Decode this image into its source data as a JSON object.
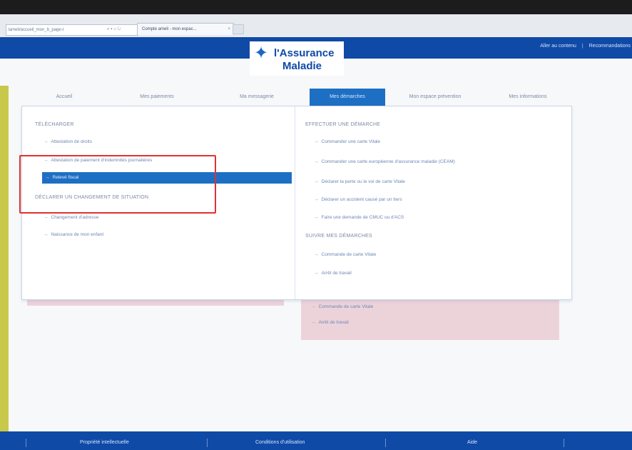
{
  "browser": {
    "address": "/ameli/accueil_mon_b_page-r",
    "address_icons": "⌕ ▾ ⌂ ↻",
    "tab_title": "Compte ameli - mon espac...",
    "tab_close": "×"
  },
  "header": {
    "top_links": [
      "Aller au contenu",
      "Recommandations"
    ],
    "separator": "|",
    "logo_line1": "l'Assurance",
    "logo_line2": "Maladie"
  },
  "nav": {
    "items": [
      {
        "label": "Accueil"
      },
      {
        "label": "Mes paiements"
      },
      {
        "label": "Ma messagerie"
      },
      {
        "label": "Mes démarches",
        "active": true
      },
      {
        "label": "Mon espace prévention"
      },
      {
        "label": "Mes informations"
      }
    ]
  },
  "dropdown": {
    "left": {
      "section1_title": "TÉLÉCHARGER",
      "section1_links": [
        "Attestation de droits",
        "Attestation de paiement d'indemnités journalières",
        "Relevé fiscal"
      ],
      "section2_title": "DÉCLARER UN CHANGEMENT DE SITUATION",
      "section2_links": [
        "Changement d'adresse",
        "Naissance de mon enfant"
      ]
    },
    "right": {
      "section1_title": "EFFECTUER UNE DÉMARCHE",
      "section1_links": [
        "Commander une carte Vitale",
        "Commander une carte européenne d'assurance maladie (CEAM)",
        "Déclarer la perte ou le vol de carte Vitale",
        "Déclarer un accident causé par un tiers",
        "Faire une demande de CMUC ou d'ACS"
      ],
      "section2_title": "SUIVRE MES DÉMARCHES",
      "section2_links": [
        "Commande de carte Vitale",
        "Arrêt de travail"
      ]
    }
  },
  "background_panel": {
    "links": [
      "Commande de carte Vitale",
      "Arrêt de travail"
    ]
  },
  "footer": {
    "items": [
      "Propriété intellectuelle",
      "Conditions d'utilisation",
      "Aide"
    ]
  },
  "icons": {
    "arrow": "→",
    "logo_glyph": "✦"
  },
  "colors": {
    "brand_blue": "#0f4aa6",
    "active_blue": "#1d6fc3",
    "highlight_red": "#e03232",
    "pink_panel": "#ecd3da"
  }
}
